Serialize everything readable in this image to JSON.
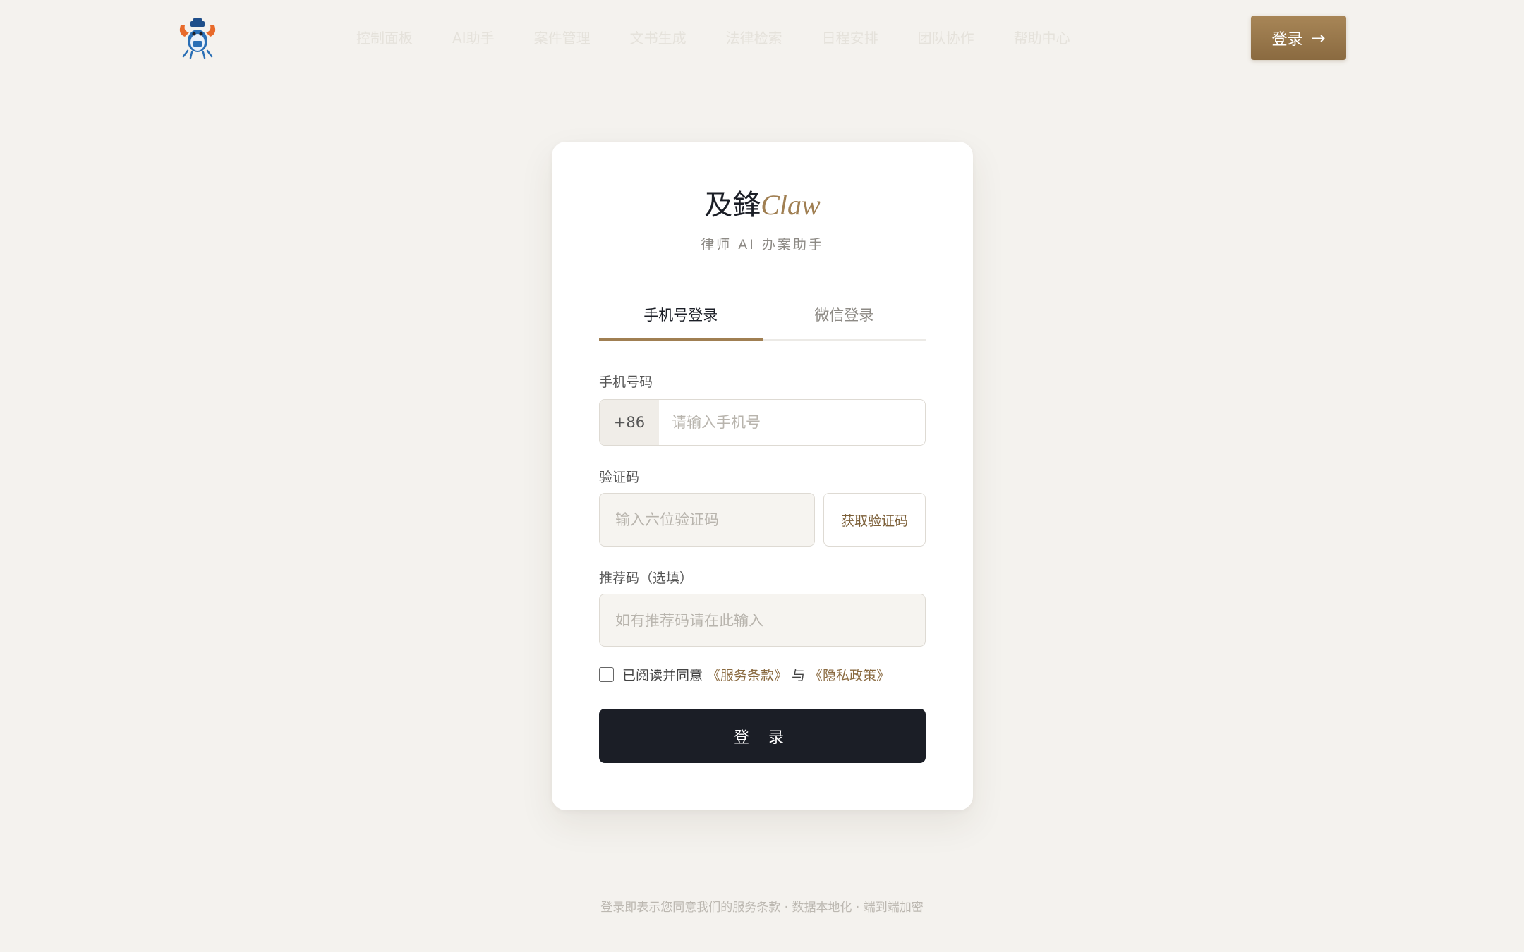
{
  "header": {
    "nav_items": [
      "控制面板",
      "AI助手",
      "案件管理",
      "文书生成",
      "法律检索",
      "日程安排",
      "团队协作",
      "帮助中心"
    ],
    "login_label": "登录",
    "login_arrow": "→"
  },
  "card": {
    "brand_cn": "及鋒",
    "brand_en": "Claw",
    "subtitle": "律师 AI 办案助手",
    "tabs": [
      {
        "label": "手机号登录",
        "active": true
      },
      {
        "label": "微信登录",
        "active": false
      }
    ],
    "phone": {
      "label": "手机号码",
      "prefix": "+86",
      "placeholder": "请输入手机号",
      "value": ""
    },
    "code": {
      "label": "验证码",
      "placeholder": "输入六位验证码",
      "button": "获取验证码"
    },
    "referral": {
      "label": "推荐码（选填）",
      "placeholder": "如有推荐码请在此输入"
    },
    "agree": {
      "prefix": "已阅读并同意",
      "terms": "《服务条款》",
      "and": "与",
      "privacy": "《隐私政策》",
      "checked": false
    },
    "submit_label": "登 录"
  },
  "footer": {
    "text": "登录即表示您同意我们的服务条款 · 数据本地化 · 端到端加密"
  },
  "colors": {
    "background": "#f4f2ee",
    "accent": "#a07f52",
    "primary_button": "#1b1e26"
  }
}
